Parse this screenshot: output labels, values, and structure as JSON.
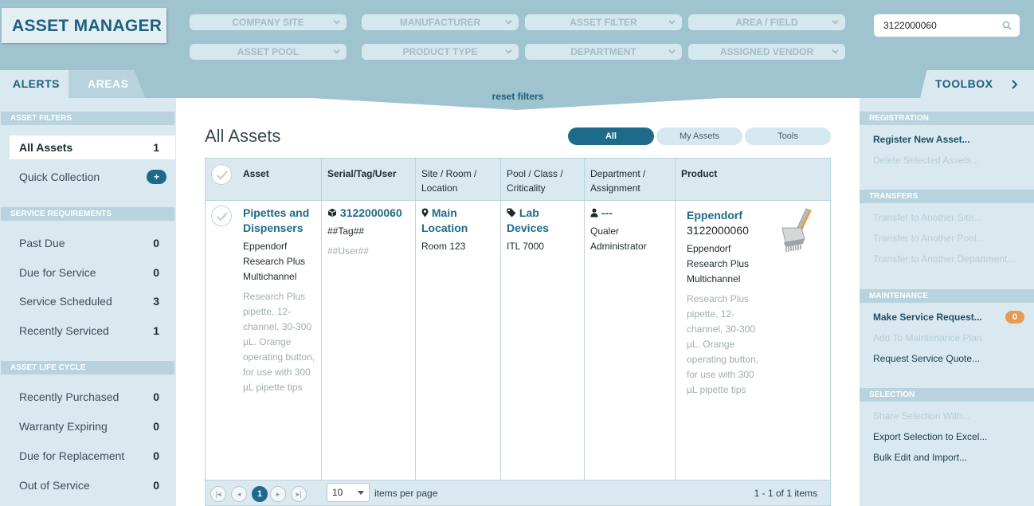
{
  "app": {
    "title": "ASSET MANAGER"
  },
  "filters": {
    "row1": [
      "COMPANY SITE",
      "MANUFACTURER",
      "ASSET FILTER",
      "AREA / FIELD"
    ],
    "row2": [
      "ASSET POOL",
      "PRODUCT TYPE",
      "DEPARTMENT",
      "ASSIGNED VENDOR"
    ]
  },
  "search": {
    "value": "3122000060",
    "icon": "search-icon"
  },
  "tabs": {
    "alerts": "ALERTS",
    "areas": "AREAS",
    "toolbox": "TOOLBOX"
  },
  "reset_filters": "reset filters",
  "left": {
    "asset_filters": {
      "header": "ASSET FILTERS",
      "all_assets": {
        "label": "All Assets",
        "count": "1"
      },
      "quick_collection": {
        "label": "Quick Collection",
        "button": "+"
      }
    },
    "service": {
      "header": "SERVICE REQUIREMENTS",
      "items": [
        {
          "label": "Past Due",
          "count": "0"
        },
        {
          "label": "Due for Service",
          "count": "0"
        },
        {
          "label": "Service Scheduled",
          "count": "3"
        },
        {
          "label": "Recently Serviced",
          "count": "1"
        }
      ]
    },
    "lifecycle": {
      "header": "ASSET LIFE CYCLE",
      "items": [
        {
          "label": "Recently Purchased",
          "count": "0"
        },
        {
          "label": "Warranty Expiring",
          "count": "0"
        },
        {
          "label": "Due for Replacement",
          "count": "0"
        },
        {
          "label": "Out of Service",
          "count": "0"
        }
      ]
    }
  },
  "main": {
    "title": "All Assets",
    "pills": [
      "All",
      "My Assets",
      "Tools"
    ],
    "columns": [
      "Asset",
      "Serial/Tag/User",
      "Site / Room / Location",
      "Pool / Class / Criticality",
      "Department / Assignment",
      "Product"
    ],
    "row": {
      "asset_name": "Pipettes and Dispensers",
      "asset_product": "Eppendorf Research Plus Multichannel",
      "asset_desc": "Research Plus pipette, 12-channel, 30-300 µL. Orange operating button, for use with 300 µL pipette tips",
      "serial": "3122000060",
      "tag": "##Tag##",
      "user": "##User##",
      "site": "Main Location",
      "room": "Room 123",
      "pool": "Lab Devices",
      "class": "ITL 7000",
      "department": "---",
      "assignment": "Qualer Administrator",
      "product_brand": "Eppendorf",
      "product_serial": "3122000060",
      "product_name": "Eppendorf Research Plus Multichannel",
      "product_desc": "Research Plus pipette, 12-channel, 30-300 µL. Orange operating button, for use with 300 µL pipette tips"
    },
    "pager": {
      "current": "1",
      "per_page": "10",
      "per_page_label": "items per page",
      "summary": "1 - 1 of 1 items"
    }
  },
  "toolbox": {
    "registration": {
      "header": "REGISTRATION",
      "register": "Register New Asset...",
      "delete": "Delete Selected Assets..."
    },
    "transfers": {
      "header": "TRANSFERS",
      "site": "Transfer to Another Site...",
      "pool": "Transfer to Another Pool...",
      "department": "Transfer to Another Department..."
    },
    "maintenance": {
      "header": "MAINTENANCE",
      "make": "Make Service Request...",
      "badge": "0",
      "plan": "Add To Maintenance Plan",
      "quote": "Request Service Quote..."
    },
    "selection": {
      "header": "SELECTION",
      "share": "Share Selection With...",
      "export": "Export Selection to Excel...",
      "bulk": "Bulk Edit and Import..."
    }
  },
  "colors": {
    "brand": "#1d5f7c",
    "accent": "#1d6a8a",
    "badge": "#e89a52",
    "panel": "#dae9ef",
    "header_bg": "#9fc3cf"
  }
}
